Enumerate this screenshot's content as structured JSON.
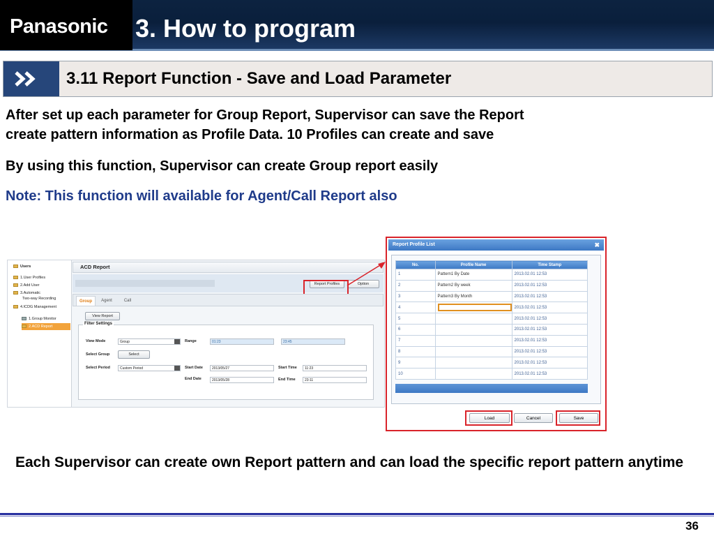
{
  "header": {
    "logo_text": "Panasonic",
    "title": "3. How to program",
    "subtitle": "3.11 Report Function  - Save and Load Parameter"
  },
  "body": {
    "para1_line1": "After set up each parameter for Group Report, Supervisor can save the Report",
    "para1_line2": "create pattern information as Profile Data.  10 Profiles can create and save",
    "para2": "By using this function, Supervisor can create Group report easily",
    "note": "Note: This function will available for Agent/Call Report also",
    "bottom": "Each Supervisor can create own Report pattern and can load the specific report pattern anytime"
  },
  "app": {
    "sidebar": {
      "users": "Users",
      "user_profiles": "1.User Profiles",
      "add_user": "2.Add User",
      "automatic": "3.Automatic",
      "two_way": "Two-way Recording",
      "icdg": "4.ICDG Management",
      "group_monitor": "1.Group Monitor",
      "acd_report": "2.ACD Report"
    },
    "title": "ACD Report",
    "report_profiles_btn": "Report Profiles",
    "option_btn": "Option",
    "tabs": [
      "Group",
      "Agent",
      "Call"
    ],
    "view_report_btn": "View Report",
    "filter_settings": "Filter Settings",
    "view_mode_label": "View Mode",
    "view_mode_value": "Group",
    "range_label": "Range",
    "range_from": "01:23",
    "range_to": "23:45",
    "select_group_label": "Select Group",
    "select_btn": "Select",
    "select_period_label": "Select Period",
    "select_period_value": "Custom Period",
    "start_date_label": "Start Date",
    "start_date": "2013/05/27",
    "start_time_label": "Start Time",
    "start_time": "11:23",
    "end_date_label": "End Date",
    "end_date": "2013/05/28",
    "end_time_label": "End Time",
    "end_time": "23:11"
  },
  "dialog": {
    "title": "Report Profile List",
    "close": "✖",
    "columns": [
      "No.",
      "Profile Name",
      "Time Stamp"
    ],
    "rows": [
      {
        "no": "1",
        "name": "Pattern1 By Date",
        "ts": "2013.02.01 12:53"
      },
      {
        "no": "2",
        "name": "Pattern2 By week",
        "ts": "2013.02.01 12:53"
      },
      {
        "no": "3",
        "name": "Pattern3 By Month",
        "ts": "2013.02.01 12:53"
      },
      {
        "no": "4",
        "name": "",
        "ts": "2013.02.01 12:53"
      },
      {
        "no": "5",
        "name": "",
        "ts": "2013.02.01 12:53"
      },
      {
        "no": "6",
        "name": "",
        "ts": "2013.02.01 12:53"
      },
      {
        "no": "7",
        "name": "",
        "ts": "2013.02.01 12:53"
      },
      {
        "no": "8",
        "name": "",
        "ts": "2013.02.01 12:53"
      },
      {
        "no": "9",
        "name": "",
        "ts": "2013.02.01 12:53"
      },
      {
        "no": "10",
        "name": "",
        "ts": "2013.02.01 12:53"
      }
    ],
    "load_btn": "Load",
    "cancel_btn": "Cancel",
    "save_btn": "Save"
  },
  "footer": {
    "page": "36"
  },
  "colors": {
    "accent_red": "#d9232a",
    "note_blue": "#1f3b8a",
    "header_navy": "#0c2340"
  }
}
